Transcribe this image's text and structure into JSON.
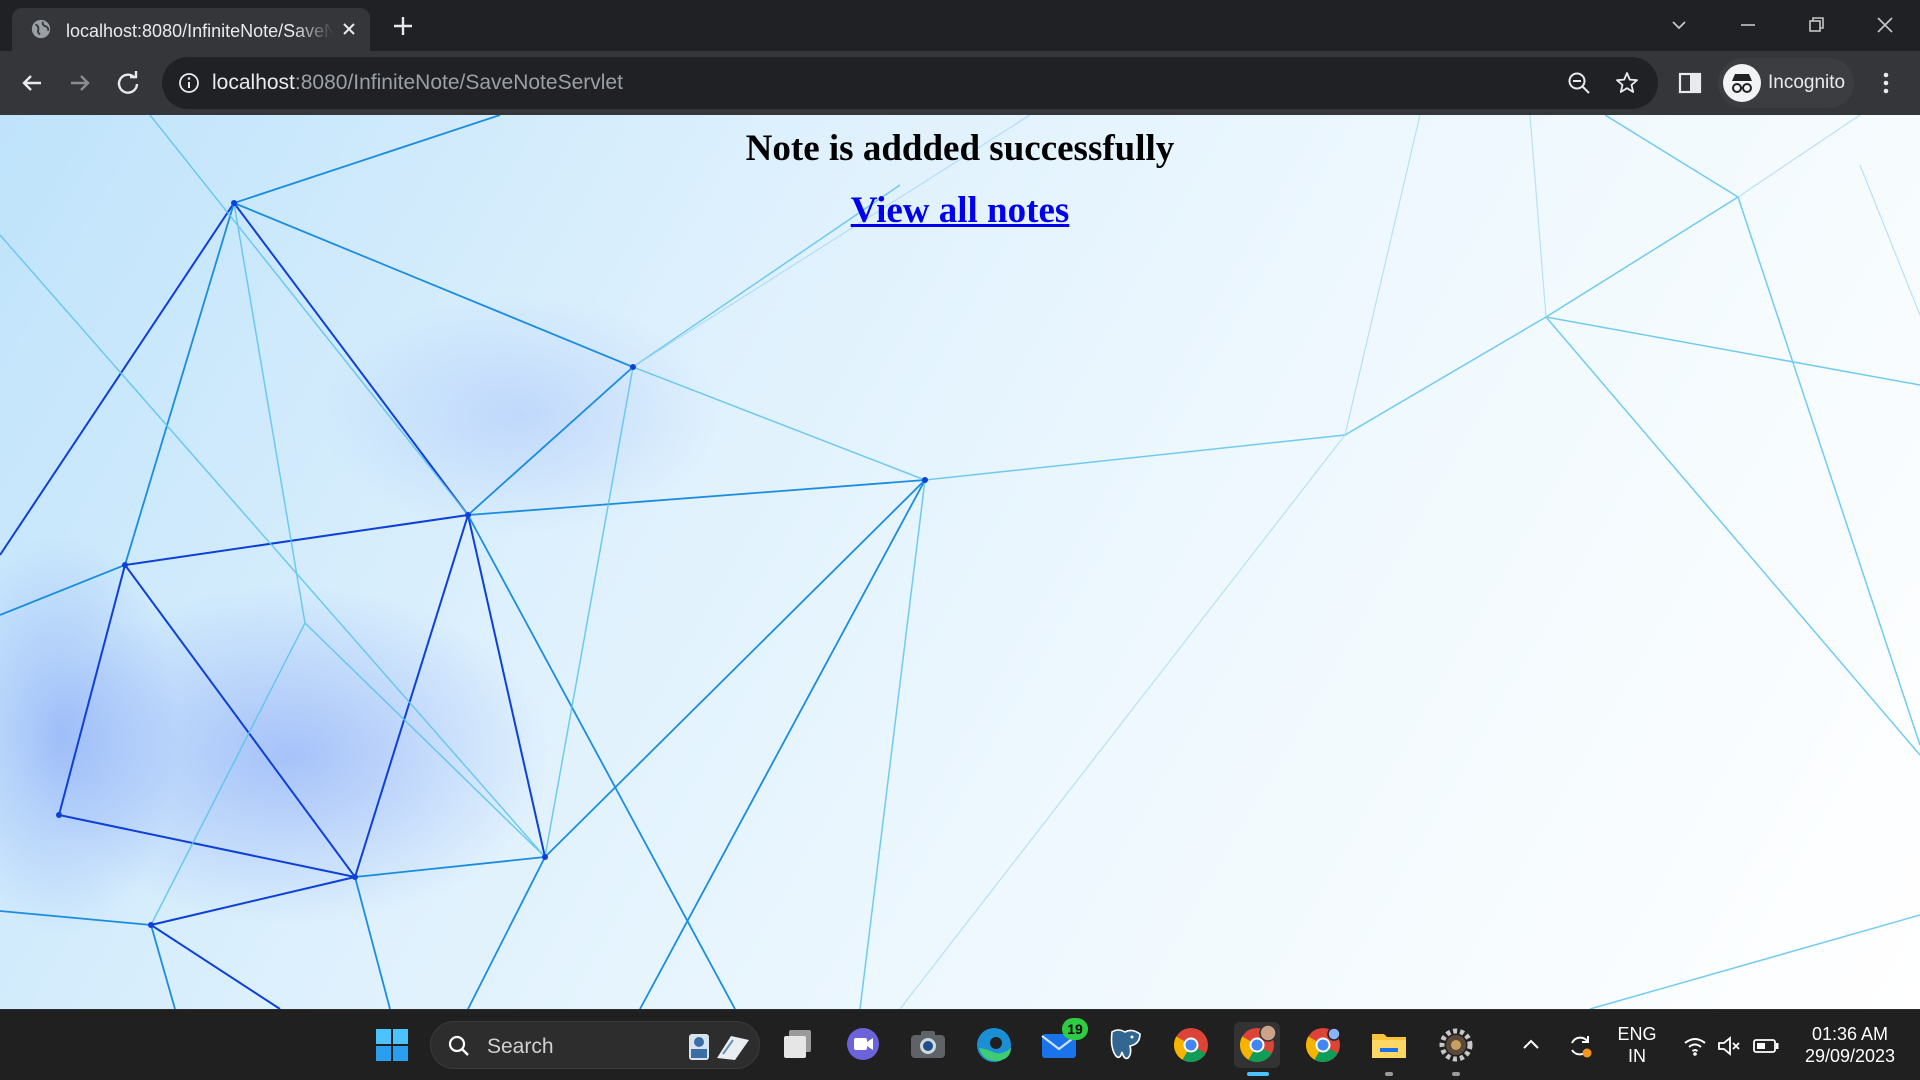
{
  "browser": {
    "tab_title": "localhost:8080/InfiniteNote/SaveNoteServlet",
    "url_host": "localhost",
    "url_rest": ":8080/InfiniteNote/SaveNoteServlet",
    "profile_label": "Incognito"
  },
  "page": {
    "heading": "Note is addded successfully",
    "link_text": "View all notes",
    "background_color": "#dff1fd",
    "link_color": "#0000ee"
  },
  "taskbar": {
    "search_label": "Search",
    "mail_badge": "19",
    "language_line1": "ENG",
    "language_line2": "IN",
    "time": "01:36 AM",
    "date": "29/09/2023",
    "apps": [
      "start-icon",
      "task-view-icon",
      "teams-chat-icon",
      "camera-icon",
      "edge-icon",
      "mail-icon",
      "postgres-icon",
      "chrome-icon",
      "chrome-profile-icon",
      "chrome-alt-icon",
      "file-explorer-icon",
      "settings-gear-icon"
    ]
  }
}
